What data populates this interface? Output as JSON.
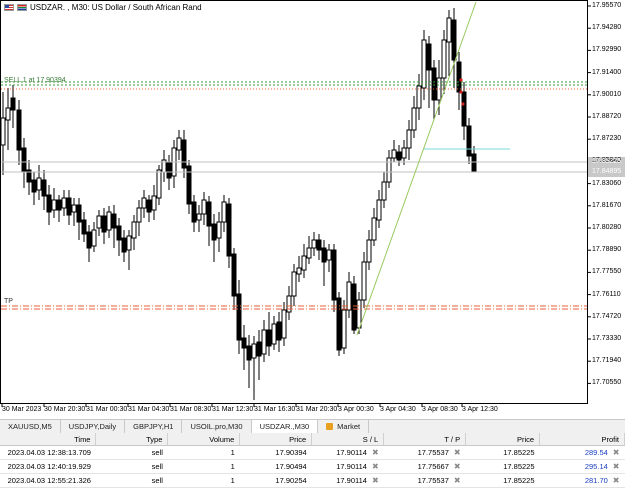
{
  "window": {
    "symbol": "USDZAR.",
    "timeframe": "M30",
    "description": "US Dollar / South African Rand",
    "title_text": "USDZAR. , M30:  US Dollar / South African Rand"
  },
  "price_axis": {
    "labels": [
      "17.95570",
      "17.94280",
      "17.92990",
      "17.91400",
      "17.90010",
      "17.88720",
      "17.87230",
      "17.85840",
      "17.83060",
      "17.81670",
      "17.80280",
      "17.78890",
      "17.77550",
      "17.76110",
      "17.74720",
      "17.73330",
      "17.71940",
      "17.70550"
    ],
    "highlight_labels": [
      "17.85225",
      "17.84895"
    ],
    "colors": {
      "bid": "#c0c0c0",
      "ask": "#c0c0c0"
    }
  },
  "time_axis": {
    "labels": [
      "30 Mar 2023",
      "30 Mar 20:30",
      "31 Mar 00:30",
      "31 Mar 04:30",
      "31 Mar 08:30",
      "31 Mar 12:30",
      "31 Mar 16:30",
      "31 Mar 20:30",
      "3 Apr 00:30",
      "3 Apr 04:30",
      "3 Apr 08:30",
      "3 Apr 12:30"
    ]
  },
  "chart_lines": {
    "sell_label": "SELL 1 at 17.90394",
    "tp_label": "TP",
    "sell_color": "#3a9a3a",
    "tp_color": "#e8603a",
    "trend_color": "#9ac860",
    "cyan_color": "#7ad8d8"
  },
  "tabs": [
    {
      "label": "XAUUSD,M5",
      "active": false
    },
    {
      "label": "USDJPY,Daily",
      "active": false
    },
    {
      "label": "GBPJPY,H1",
      "active": false
    },
    {
      "label": "USOIL.pro,M30",
      "active": false
    },
    {
      "label": "USDZAR.,M30",
      "active": true
    },
    {
      "label": "Market",
      "active": false,
      "icon": "shopping-bag-icon"
    }
  ],
  "table": {
    "headers": [
      "Time",
      "Type",
      "Volume",
      "Price",
      "S / L",
      "T / P",
      "Price",
      "Profit"
    ],
    "rows": [
      {
        "time": "2023.04.03 12:38:13.709",
        "type": "sell",
        "volume": "1",
        "price": "17.90394",
        "sl": "17.90114",
        "tp": "17.75537",
        "cur_price": "17.85225",
        "profit": "289.54"
      },
      {
        "time": "2023.04.03 12:40:19.929",
        "type": "sell",
        "volume": "1",
        "price": "17.90494",
        "sl": "17.90114",
        "tp": "17.75667",
        "cur_price": "17.85225",
        "profit": "295.14"
      },
      {
        "time": "2023.04.03 12:55:21.326",
        "type": "sell",
        "volume": "1",
        "price": "17.90254",
        "sl": "17.90114",
        "tp": "17.75537",
        "cur_price": "17.85225",
        "profit": "281.70"
      }
    ],
    "profit_color": "#1a3fc0"
  }
}
